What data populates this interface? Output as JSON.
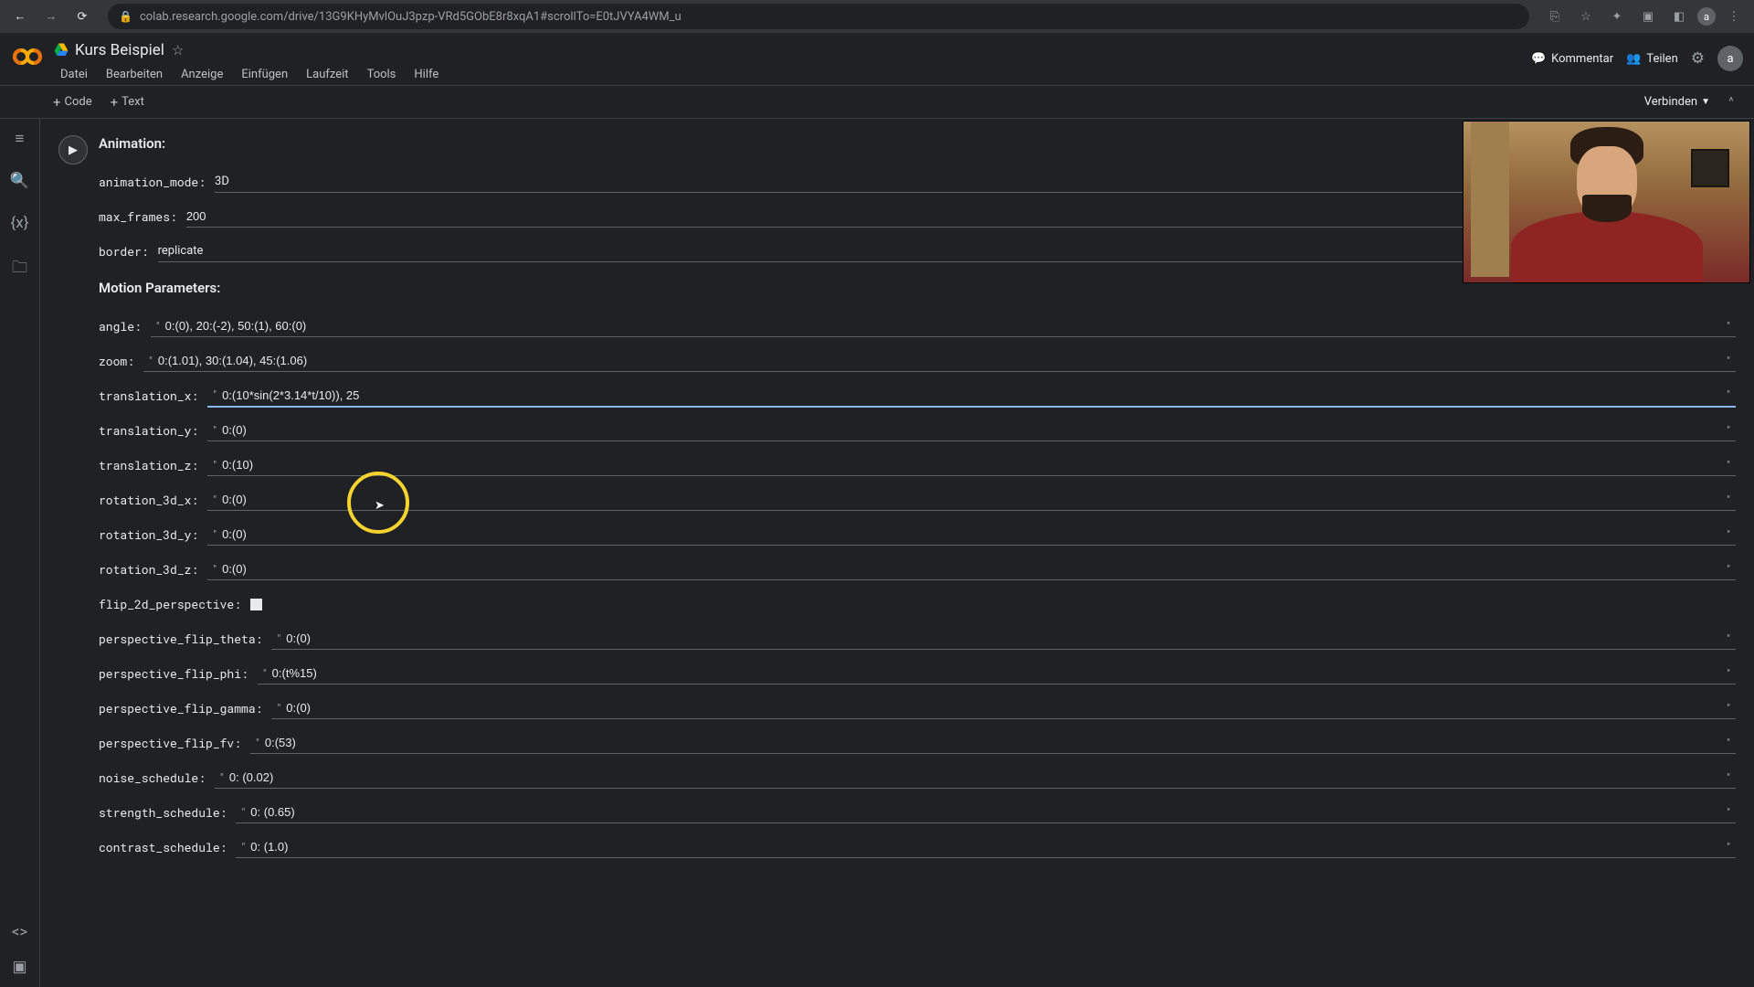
{
  "browser": {
    "url": "colab.research.google.com/drive/13G9KHyMvlOuJ3pzp-VRd5GObE8r8xqA1#scrollTo=E0tJVYA4WM_u",
    "avatar": "a"
  },
  "header": {
    "title": "Kurs Beispiel",
    "menus": [
      "Datei",
      "Bearbeiten",
      "Anzeige",
      "Einfügen",
      "Laufzeit",
      "Tools",
      "Hilfe"
    ],
    "comment": "Kommentar",
    "share": "Teilen",
    "avatar": "a"
  },
  "toolbar": {
    "code": "Code",
    "text": "Text",
    "connect": "Verbinden"
  },
  "cell": {
    "section1": "Animation:",
    "section2": "Motion Parameters:",
    "params": {
      "animation_mode": {
        "label": "animation_mode:",
        "value": "3D",
        "type": "select"
      },
      "max_frames": {
        "label": "max_frames:",
        "value": "200",
        "type": "input"
      },
      "border": {
        "label": "border:",
        "value": "replicate",
        "type": "select"
      },
      "angle": {
        "label": "angle:",
        "value": "0:(0), 20:(-2), 50:(1), 60:(0)"
      },
      "zoom": {
        "label": "zoom:",
        "value": "0:(1.01), 30:(1.04), 45:(1.06)"
      },
      "translation_x": {
        "label": "translation_x:",
        "value": "0:(10*sin(2*3.14*t/10)), 25",
        "focused": true
      },
      "translation_y": {
        "label": "translation_y:",
        "value": "0:(0)"
      },
      "translation_z": {
        "label": "translation_z:",
        "value": "0:(10)"
      },
      "rotation_3d_x": {
        "label": "rotation_3d_x:",
        "value": "0:(0)"
      },
      "rotation_3d_y": {
        "label": "rotation_3d_y:",
        "value": "0:(0)"
      },
      "rotation_3d_z": {
        "label": "rotation_3d_z:",
        "value": "0:(0)"
      },
      "flip_2d_perspective": {
        "label": "flip_2d_perspective:",
        "value": "",
        "type": "checkbox"
      },
      "perspective_flip_theta": {
        "label": "perspective_flip_theta:",
        "value": "0:(0)"
      },
      "perspective_flip_phi": {
        "label": "perspective_flip_phi:",
        "value": "0:(t%15)"
      },
      "perspective_flip_gamma": {
        "label": "perspective_flip_gamma:",
        "value": "0:(0)"
      },
      "perspective_flip_fv": {
        "label": "perspective_flip_fv:",
        "value": "0:(53)"
      },
      "noise_schedule": {
        "label": "noise_schedule:",
        "value": "0: (0.02)"
      },
      "strength_schedule": {
        "label": "strength_schedule:",
        "value": "0: (0.65)"
      },
      "contrast_schedule": {
        "label": "contrast_schedule:",
        "value": "0: (1.0)"
      }
    }
  }
}
